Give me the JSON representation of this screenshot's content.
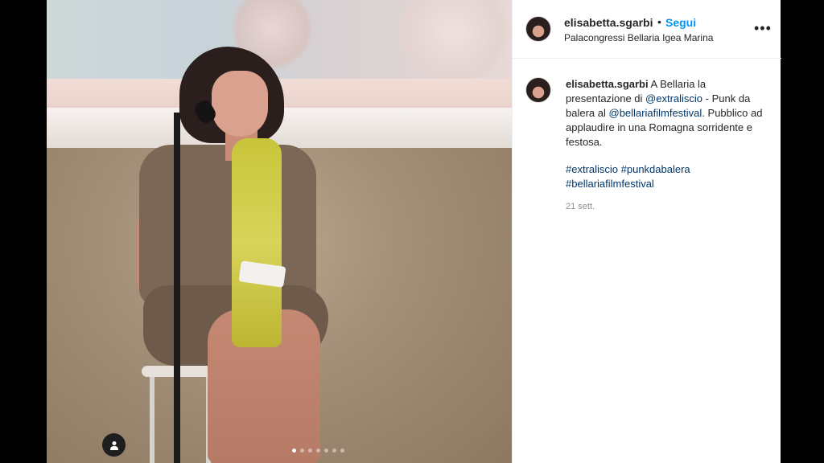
{
  "post": {
    "username": "elisabetta.sgarbi",
    "separator": "•",
    "follow_label": "Segui",
    "location": "Palacongressi Bellaria Igea Marina",
    "more_icon": "more-options-icon",
    "caption": {
      "username": "elisabetta.sgarbi",
      "text_1": "A Bellaria la presentazione di",
      "mention_1": "@extraliscio",
      "text_2": "- Punk da balera al",
      "mention_2": "@bellariafilmfestival",
      "text_3": ". Pubblico ad applaudire in una Romagna sorridente e festosa.",
      "hashtags": "#extraliscio #punkdabalera #bellariafilmfestival"
    },
    "date": "21 sett."
  },
  "media": {
    "next_icon": "chevron-right-icon",
    "tag_icon": "user-tag-icon",
    "carousel_count": 7,
    "carousel_active_index": 0
  },
  "colors": {
    "follow": "#0095f6",
    "link": "#00376b",
    "text": "#262626",
    "muted": "#8e8e8e"
  }
}
